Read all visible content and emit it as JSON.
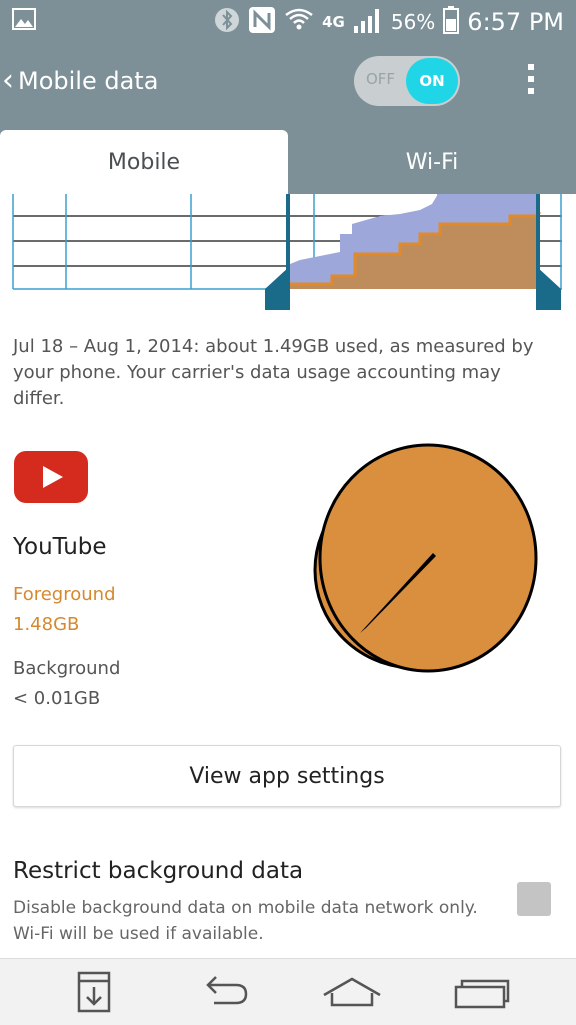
{
  "status_bar": {
    "network_label": "4G",
    "battery_percent": "56%",
    "time": "6:57 PM",
    "icons": [
      "image-notification-icon",
      "bluetooth-icon",
      "nfc-icon",
      "wifi-icon",
      "signal-icon",
      "battery-icon"
    ]
  },
  "action_bar": {
    "title": "Mobile data",
    "toggle": {
      "off_label": "OFF",
      "on_label": "ON",
      "state": "on"
    }
  },
  "tabs": [
    {
      "label": "Mobile",
      "selected": true
    },
    {
      "label": "Wi-Fi",
      "selected": false
    }
  ],
  "usage_summary": "Jul 18 – Aug 1, 2014: about 1.49GB used, as measured by your phone. Your carrier's data usage accounting may differ.",
  "app": {
    "name": "YouTube",
    "icon": "youtube-icon",
    "foreground_label": "Foreground",
    "foreground_value": "1.48GB",
    "background_label": "Background",
    "background_value": "< 0.01GB"
  },
  "view_settings_label": "View app settings",
  "restrict": {
    "title": "Restrict background data",
    "description": "Disable background data on mobile data network only. Wi-Fi will be used if available.",
    "checked": false
  },
  "nav_bar": {
    "icons": [
      "notification-save-icon",
      "back-icon",
      "home-icon",
      "recent-apps-icon"
    ]
  },
  "colors": {
    "action_bar": "#7d8f97",
    "accent_cyan": "#20d6e6",
    "foreground_orange": "#d5892f",
    "chart_total": "#9da7d9",
    "chart_app": "#bf8c5c",
    "chart_handle": "#1a6a8a"
  }
}
